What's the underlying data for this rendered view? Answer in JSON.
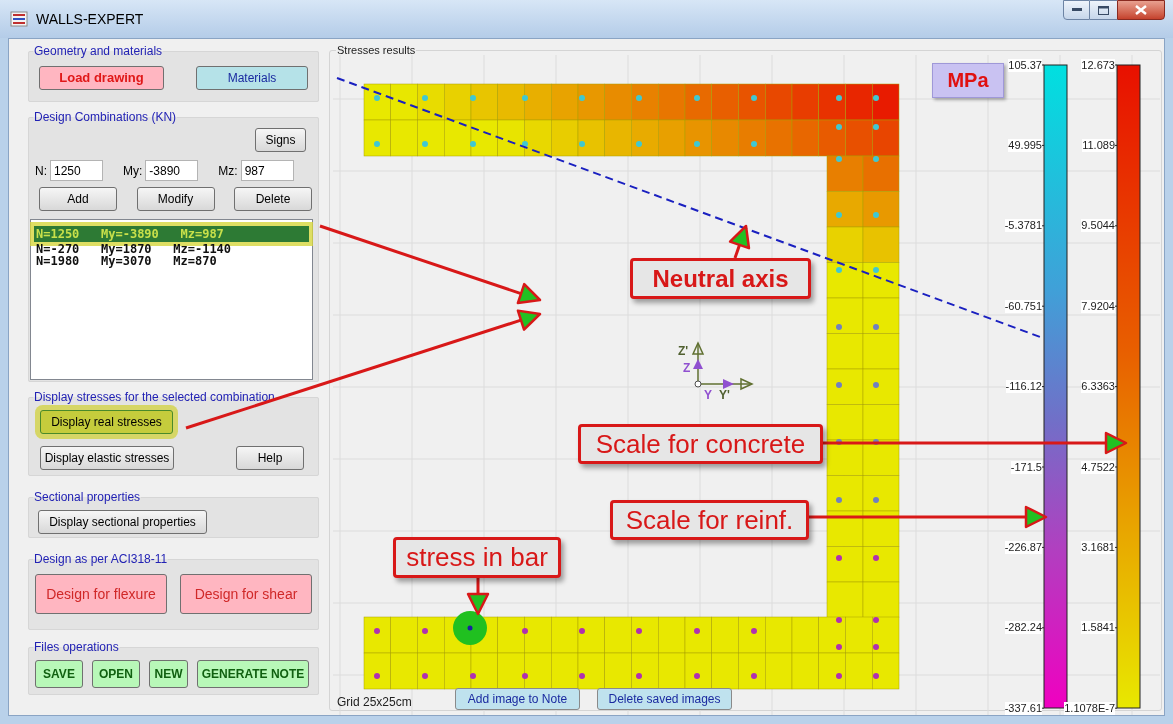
{
  "window": {
    "title": "WALLS-EXPERT"
  },
  "geometry_and_materials": {
    "title": "Geometry and materials",
    "buttons": [
      {
        "label": "Load drawing",
        "kind": "load"
      },
      {
        "label": "Materials",
        "kind": "materials"
      }
    ]
  },
  "design_combinations": {
    "title": "Design Combinations (KN)",
    "signs_button": "Signs",
    "fields": [
      {
        "label": "N:",
        "value": "1250"
      },
      {
        "label": "My:",
        "value": "-3890"
      },
      {
        "label": "Mz:",
        "value": "987"
      }
    ],
    "buttons": [
      "Add",
      "Modify",
      "Delete"
    ],
    "list": [
      {
        "text": "N=1250   My=-3890   Mz=987",
        "selected": true
      },
      {
        "text": "N=-270   My=1870   Mz=-1140",
        "selected": false
      },
      {
        "text": "N=1980   My=3070   Mz=870",
        "selected": false
      }
    ]
  },
  "display_stresses": {
    "title": "Display stresses for the selected combination",
    "buttons": [
      {
        "label": "Display real stresses",
        "highlighted": true
      },
      {
        "label": "Display elastic stresses",
        "highlighted": false
      },
      {
        "label": "Help",
        "highlighted": false
      }
    ]
  },
  "sectional_properties": {
    "title": "Sectional properties",
    "buttons": [
      "Display sectional properties"
    ]
  },
  "design": {
    "title": "Design as per ACI318-11",
    "buttons": [
      "Design for flexure",
      "Design for shear"
    ]
  },
  "files_operations": {
    "title": "Files operations",
    "buttons": [
      "SAVE",
      "OPEN",
      "NEW",
      "GENERATE NOTE"
    ]
  },
  "stresses_results": {
    "title": "Stresses results",
    "unit": "MPa",
    "axis_labels": [
      {
        "text": "Z'",
        "kind": "z_prime"
      },
      {
        "text": "Z",
        "kind": "z"
      },
      {
        "text": "Y",
        "kind": "y"
      },
      {
        "text": "Y'",
        "kind": "y_prime"
      }
    ],
    "reinf_scale": {
      "ticks": [
        "105.37",
        "49.995",
        "-5.3781",
        "-60.751",
        "-116.12",
        "-171.5",
        "-226.87",
        "-282.24",
        "-337.61"
      ]
    },
    "concrete_scale": {
      "ticks": [
        "12.673",
        "11.089",
        "9.5044",
        "7.9204",
        "6.3363",
        "4.7522",
        "3.1681",
        "1.5841",
        "1.1078E-7"
      ]
    },
    "grid_label": "Grid 25x25cm",
    "buttons": [
      "Add image to Note",
      "Delete saved images"
    ]
  },
  "callouts": [
    {
      "text": "Neutral axis",
      "kind": "neutral_axis"
    },
    {
      "text": "Scale for concrete",
      "kind": "concrete_scale"
    },
    {
      "text": "Scale for reinf.",
      "kind": "reinf_scale"
    },
    {
      "text": "stress in bar",
      "kind": "bar"
    }
  ]
}
